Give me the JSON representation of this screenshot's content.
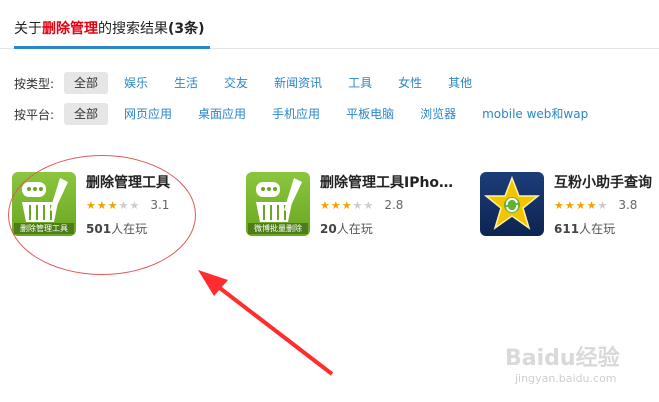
{
  "header": {
    "prefix": "关于",
    "keyword": "删除管理",
    "suffix": "的搜索结果",
    "count": "(3条)"
  },
  "filters": {
    "type": {
      "label": "按类型:",
      "options": [
        "全部",
        "娱乐",
        "生活",
        "交友",
        "新闻资讯",
        "工具",
        "女性",
        "其他"
      ],
      "active": 0
    },
    "platform": {
      "label": "按平台:",
      "options": [
        "全部",
        "网页应用",
        "桌面应用",
        "手机应用",
        "平板电脑",
        "浏览器",
        "mobile web和wap"
      ],
      "active": 0
    }
  },
  "apps": [
    {
      "name": "删除管理工具",
      "rating": 3.1,
      "rating_text": "3.1",
      "players": "501",
      "players_suffix": "人在玩",
      "icon_text": "删除管理工具",
      "icon": "trash-basket-icon"
    },
    {
      "name": "删除管理工具IPho…",
      "rating": 2.8,
      "rating_text": "2.8",
      "players": "20",
      "players_suffix": "人在玩",
      "icon_text": "微博批量删除",
      "icon": "trash-basket-icon"
    },
    {
      "name": "互粉小助手查询",
      "rating": 3.8,
      "rating_text": "3.8",
      "players": "611",
      "players_suffix": "人在玩",
      "icon": "star-icon"
    }
  ],
  "watermark": {
    "text": "Baidu经验",
    "sub": "jingyan.baidu.com"
  },
  "colors": {
    "accent": "#2c86c7",
    "keyword": "#e60012",
    "star": "#f0a400",
    "annotation": "#e05a5a"
  }
}
